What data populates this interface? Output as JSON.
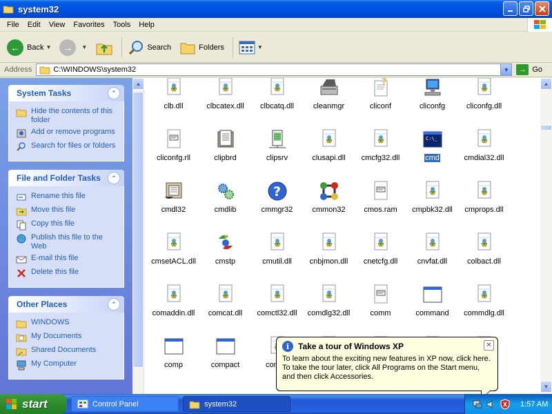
{
  "window": {
    "title": "system32"
  },
  "menu": [
    "File",
    "Edit",
    "View",
    "Favorites",
    "Tools",
    "Help"
  ],
  "toolbar": {
    "back": "Back",
    "search": "Search",
    "folders": "Folders"
  },
  "address": {
    "label": "Address",
    "value": "C:\\WINDOWS\\system32",
    "go": "Go"
  },
  "taskpane": {
    "system_tasks": {
      "title": "System Tasks",
      "items": [
        "Hide the contents of this folder",
        "Add or remove programs",
        "Search for files or folders"
      ]
    },
    "file_folder_tasks": {
      "title": "File and Folder Tasks",
      "items": [
        "Rename this file",
        "Move this file",
        "Copy this file",
        "Publish this file to the Web",
        "E-mail this file",
        "Delete this file"
      ]
    },
    "other_places": {
      "title": "Other Places",
      "items": [
        "WINDOWS",
        "My Documents",
        "Shared Documents",
        "My Computer"
      ]
    }
  },
  "files": [
    {
      "name": "clb.dll",
      "icon": "dll-icon"
    },
    {
      "name": "clbcatex.dll",
      "icon": "dll-icon"
    },
    {
      "name": "clbcatq.dll",
      "icon": "dll-icon"
    },
    {
      "name": "cleanmgr",
      "icon": "disk-cleanup-icon"
    },
    {
      "name": "cliconf",
      "icon": "help-file-icon"
    },
    {
      "name": "cliconfg",
      "icon": "network-computer-icon"
    },
    {
      "name": "cliconfg.dll",
      "icon": "dll-icon"
    },
    {
      "name": "cliconfg.rll",
      "icon": "generic-file-icon"
    },
    {
      "name": "clipbrd",
      "icon": "clipbook-icon"
    },
    {
      "name": "clipsrv",
      "icon": "clipboard-server-icon"
    },
    {
      "name": "clusapi.dll",
      "icon": "dll-icon"
    },
    {
      "name": "cmcfg32.dll",
      "icon": "dll-icon"
    },
    {
      "name": "cmd",
      "icon": "command-prompt-icon",
      "selected": true
    },
    {
      "name": "cmdial32.dll",
      "icon": "dll-icon"
    },
    {
      "name": "cmdl32",
      "icon": "phone-book-icon"
    },
    {
      "name": "cmdlib",
      "icon": "gears-icon"
    },
    {
      "name": "cmmgr32",
      "icon": "help-icon"
    },
    {
      "name": "cmmon32",
      "icon": "connection-monitor-icon"
    },
    {
      "name": "cmos.ram",
      "icon": "generic-file-icon"
    },
    {
      "name": "cmpbk32.dll",
      "icon": "dll-icon"
    },
    {
      "name": "cmprops.dll",
      "icon": "dll-icon"
    },
    {
      "name": "cmsetACL.dll",
      "icon": "dll-icon"
    },
    {
      "name": "cmstp",
      "icon": "setup-icon"
    },
    {
      "name": "cmutil.dll",
      "icon": "dll-icon"
    },
    {
      "name": "cnbjmon.dll",
      "icon": "dll-icon"
    },
    {
      "name": "cnetcfg.dll",
      "icon": "dll-icon"
    },
    {
      "name": "cnvfat.dll",
      "icon": "dll-icon"
    },
    {
      "name": "colbact.dll",
      "icon": "dll-icon"
    },
    {
      "name": "comaddin.dll",
      "icon": "dll-icon"
    },
    {
      "name": "comcat.dll",
      "icon": "dll-icon"
    },
    {
      "name": "comctl32.dll",
      "icon": "dll-icon"
    },
    {
      "name": "comdlg32.dll",
      "icon": "dll-icon"
    },
    {
      "name": "comm",
      "icon": "generic-file-icon"
    },
    {
      "name": "command",
      "icon": "window-app-icon"
    },
    {
      "name": "commdlg.dll",
      "icon": "dll-icon"
    },
    {
      "name": "comp",
      "icon": "window-app-icon"
    },
    {
      "name": "compact",
      "icon": "window-app-icon"
    },
    {
      "name": "compa",
      "icon": "dll-icon"
    },
    {
      "name": "",
      "icon": "dll-icon"
    },
    {
      "name": "",
      "icon": "dll-icon"
    },
    {
      "name": "",
      "icon": "dll-icon"
    },
    {
      "name": "",
      "icon": "dll-icon"
    }
  ],
  "balloon": {
    "title": "Take a tour of Windows XP",
    "line1": "To learn about the exciting new features in XP now, click here.",
    "line2": "To take the tour later, click All Programs on the Start menu,",
    "line3": "and then click Accessories."
  },
  "taskbar": {
    "start": "start",
    "items": [
      "Control Panel",
      "system32"
    ],
    "clock": "1:57 AM"
  },
  "colors": {
    "xp_blue": "#0054e3",
    "task_link": "#215dc6",
    "selection": "#316ac5",
    "start_green": "#2e8b2e",
    "balloon_bg": "#ffffe1"
  }
}
